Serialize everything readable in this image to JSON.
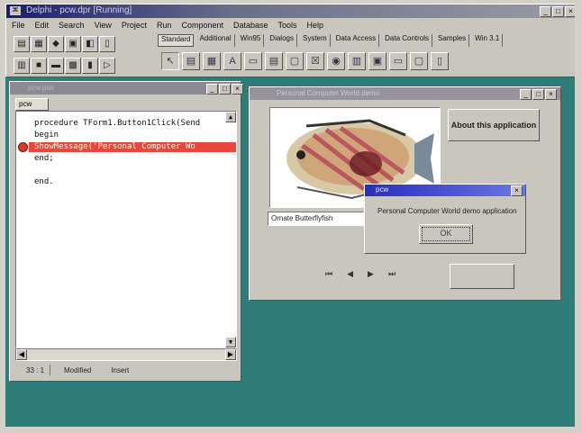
{
  "ide": {
    "title": "Delphi - pcw.dpr [Running]",
    "menu": [
      "File",
      "Edit",
      "Search",
      "View",
      "Project",
      "Run",
      "Component",
      "Database",
      "Tools",
      "Help"
    ],
    "palette_tabs": [
      "Standard",
      "Additional",
      "Win95",
      "Dialogs",
      "System",
      "Data Access",
      "Data Controls",
      "Samples",
      "Win 3.1"
    ],
    "active_tab": "Standard",
    "window_buttons": [
      "_",
      "□",
      "×"
    ]
  },
  "editor": {
    "title": "pcw.pas",
    "tab": "pcw",
    "code": [
      "procedure TForm1.Button1Click(Send",
      "begin",
      "ShowMessage('Personal Computer Wo",
      "end;",
      "",
      "end."
    ],
    "status": {
      "position": "33 : 1",
      "state": "Modified",
      "mode": "Insert"
    }
  },
  "form": {
    "title": "Personal Computer World demo",
    "about_button": "About this application",
    "caption": "Ornate Butterflyfish",
    "media_controls": [
      "⏮",
      "◀",
      "▶",
      "⏭"
    ]
  },
  "msgbox": {
    "title": "pcw",
    "message": "Personal Computer World demo application",
    "ok_label": "OK",
    "close": "×"
  }
}
